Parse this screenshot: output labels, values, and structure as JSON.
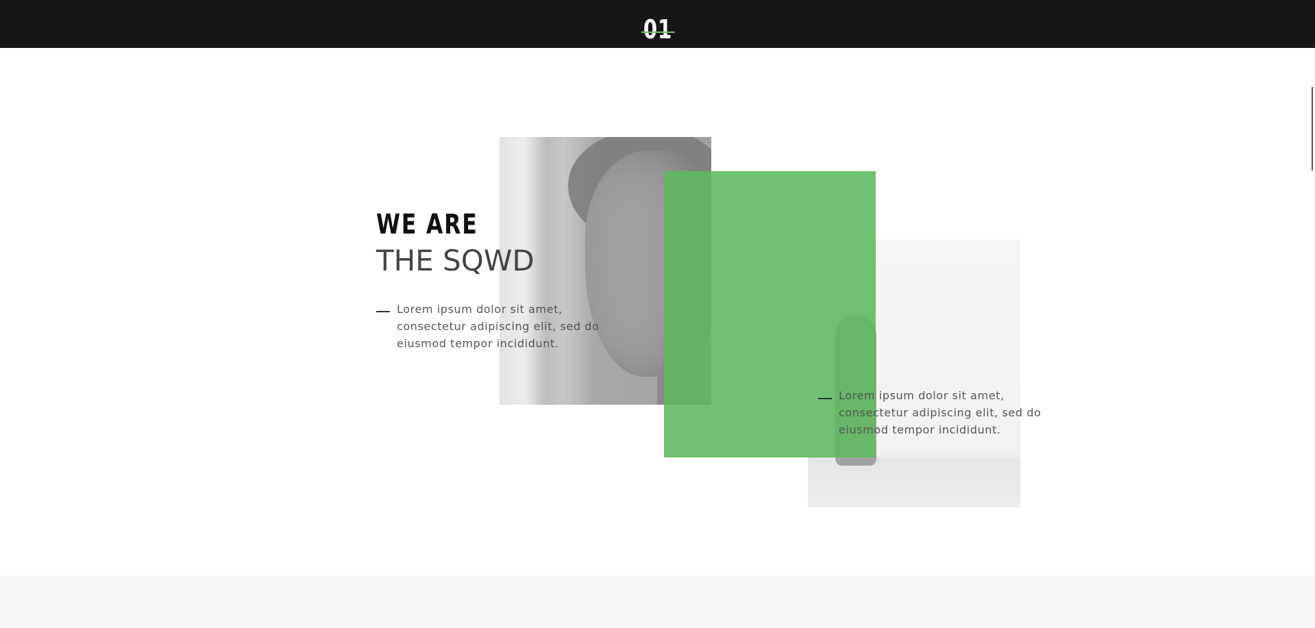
{
  "header": {
    "slide_number": "01"
  },
  "hero": {
    "headline_line1": "WE ARE",
    "headline_line2": "THE SQWD",
    "paragraph_left": "Lorem ipsum dolor sit amet, consectetur adipiscing elit, sed do eiusmod tempor incididunt.",
    "paragraph_right": "Lorem ipsum dolor sit amet, consectetur adipiscing elit, sed do eiusmod tempor incididunt."
  },
  "colors": {
    "topbar": "#161616",
    "accent": "#5cb85f",
    "text_dark": "#111111",
    "text_muted": "#555555",
    "bottom_band": "#f8f8f8"
  }
}
